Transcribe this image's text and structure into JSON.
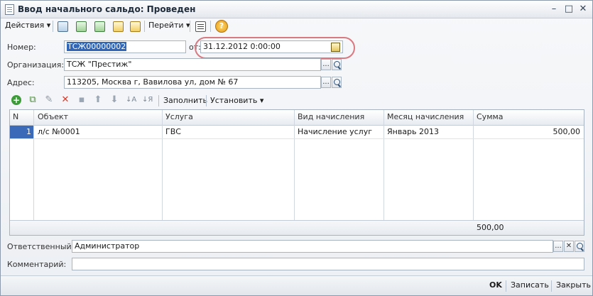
{
  "window": {
    "title": "Ввод начального сальдо: Проведен",
    "minimize": "–",
    "maximize": "□",
    "close": "✕"
  },
  "toolbar": {
    "actions": "Действия",
    "goto": "Перейти",
    "help": "?"
  },
  "form": {
    "number_label": "Номер:",
    "number_value": "ТСЖ00000002",
    "date_label": "от:",
    "date_value": "31.12.2012  0:00:00",
    "org_label": "Организация:",
    "org_value": "ТСЖ \"Престиж\"",
    "address_label": "Адрес:",
    "address_value": "113205, Москва г, Вавилова ул, дом № 67",
    "ellipsis": "..."
  },
  "table_toolbar": {
    "fill": "Заполнить",
    "set": "Установить"
  },
  "table": {
    "columns": [
      "N",
      "Объект",
      "Услуга",
      "Вид начисления",
      "Месяц начисления",
      "Сумма"
    ],
    "rows": [
      {
        "n": "1",
        "object": "л/с №0001",
        "service": "ГВС",
        "type": "Начисление услуг",
        "month": "Январь 2013",
        "sum": "500,00"
      }
    ],
    "total": "500,00"
  },
  "footer_fields": {
    "responsible_label": "Ответственный:",
    "responsible_value": "Администратор",
    "comment_label": "Комментарий:",
    "comment_value": "",
    "clear": "✕"
  },
  "bottom": {
    "ok": "OK",
    "save": "Записать",
    "close": "Закрыть"
  }
}
